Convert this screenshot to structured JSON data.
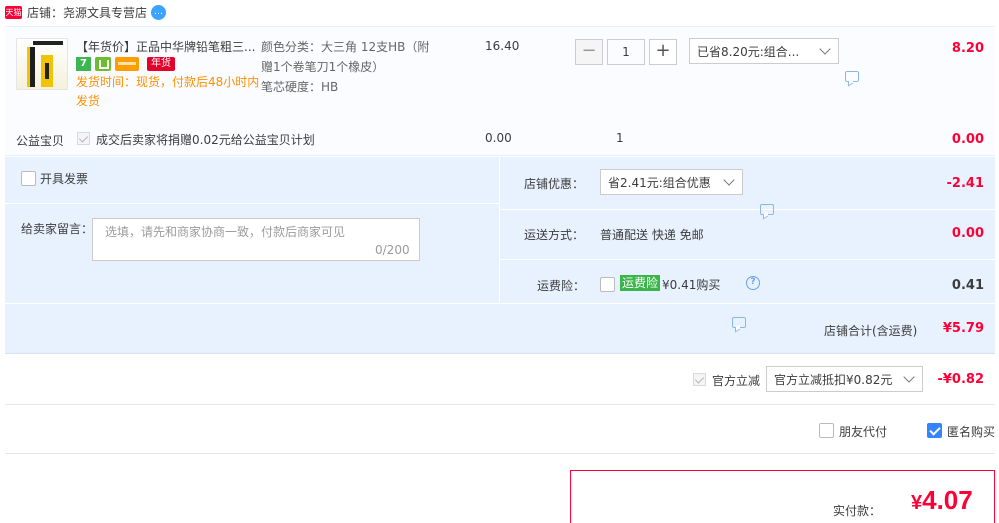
{
  "shop": {
    "badge": "天猫",
    "label": "店铺：",
    "name": "尧源文具专营店",
    "ww_icon": "chat-bubble-icon"
  },
  "item": {
    "title": "【年货价】正品中华牌铅笔粗三...",
    "badges": {
      "seven": "7",
      "nian": "年货"
    },
    "ship_time": "发货时间：现货，付款后48小时内发货",
    "sku_color": "颜色分类：大三角 12支HB（附赠1个卷笔刀1个橡皮）",
    "sku_core": "笔芯硬度：HB",
    "price": "16.40",
    "qty_minus": "−",
    "qty": "1",
    "qty_plus": "+",
    "promo": "已省8.20元:组合...",
    "sum": "8.20"
  },
  "charity": {
    "label": "公益宝贝",
    "text": "成交后卖家将捐赠0.02元给公益宝贝计划",
    "price": "0.00",
    "qty": "1",
    "sum": "0.00"
  },
  "panel": {
    "invoice": "开具发票",
    "msg_label": "给卖家留言：",
    "msg_placeholder": "选填，请先和商家协商一致，付款后商家可见",
    "msg_count": "0/200",
    "discount_label": "店铺优惠：",
    "discount_value": "省2.41元:组合优惠",
    "discount_sum": "-2.41",
    "ship_label": "运送方式：",
    "ship_value": "普通配送 快递 免邮",
    "ship_sum": "0.00",
    "ins_label": "运费险：",
    "ins_tag": "运费险",
    "ins_price": "¥0.41购买",
    "ins_sum": "0.41",
    "shop_total_label": "店铺合计(含运费)",
    "shop_total": "¥5.79"
  },
  "official": {
    "label": "官方立减",
    "select": "官方立减抵扣¥0.82元",
    "sum": "-¥0.82"
  },
  "options": {
    "friend": "朋友代付",
    "anon": "匿名购买"
  },
  "pay": {
    "label": "实付款：",
    "currency": "¥",
    "amount": "4.07"
  },
  "colors": {
    "accent": "#ff0036",
    "panel": "#e8f2ff",
    "orange": "#ff9000",
    "checkbox": "#3385ff"
  }
}
